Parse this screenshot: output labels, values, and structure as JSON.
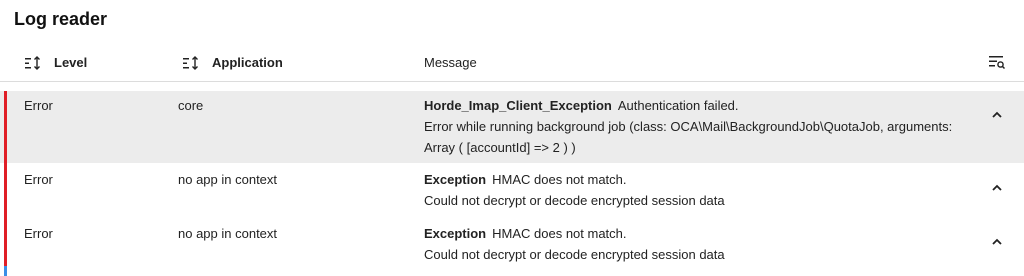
{
  "app": {
    "title": "Log reader"
  },
  "header": {
    "level_label": "Level",
    "application_label": "Application",
    "message_label": "Message",
    "sort_icon": "sort-icon",
    "filter_icon": "filter-list-icon"
  },
  "rows": [
    {
      "level": "Error",
      "application": "core",
      "exception": "Horde_Imap_Client_Exception",
      "exception_message": "Authentication failed.",
      "detail_line1": "Error while running background job (class: OCA\\Mail\\BackgroundJob\\QuotaJob, arguments:",
      "detail_line2": "Array ( [accountId] => 2 ) )",
      "highlighted": true
    },
    {
      "level": "Error",
      "application": "no app in context",
      "exception": "Exception",
      "exception_message": "HMAC does not match.",
      "detail_line1": "Could not decrypt or decode encrypted session data",
      "highlighted": false
    },
    {
      "level": "Error",
      "application": "no app in context",
      "exception": "Exception",
      "exception_message": "HMAC does not match.",
      "detail_line1": "Could not decrypt or decode encrypted session data",
      "highlighted": false
    }
  ],
  "colors": {
    "error_stripe": "#e01e26",
    "highlight_row": "#ececec",
    "accent_blue": "#3a8ee6"
  }
}
